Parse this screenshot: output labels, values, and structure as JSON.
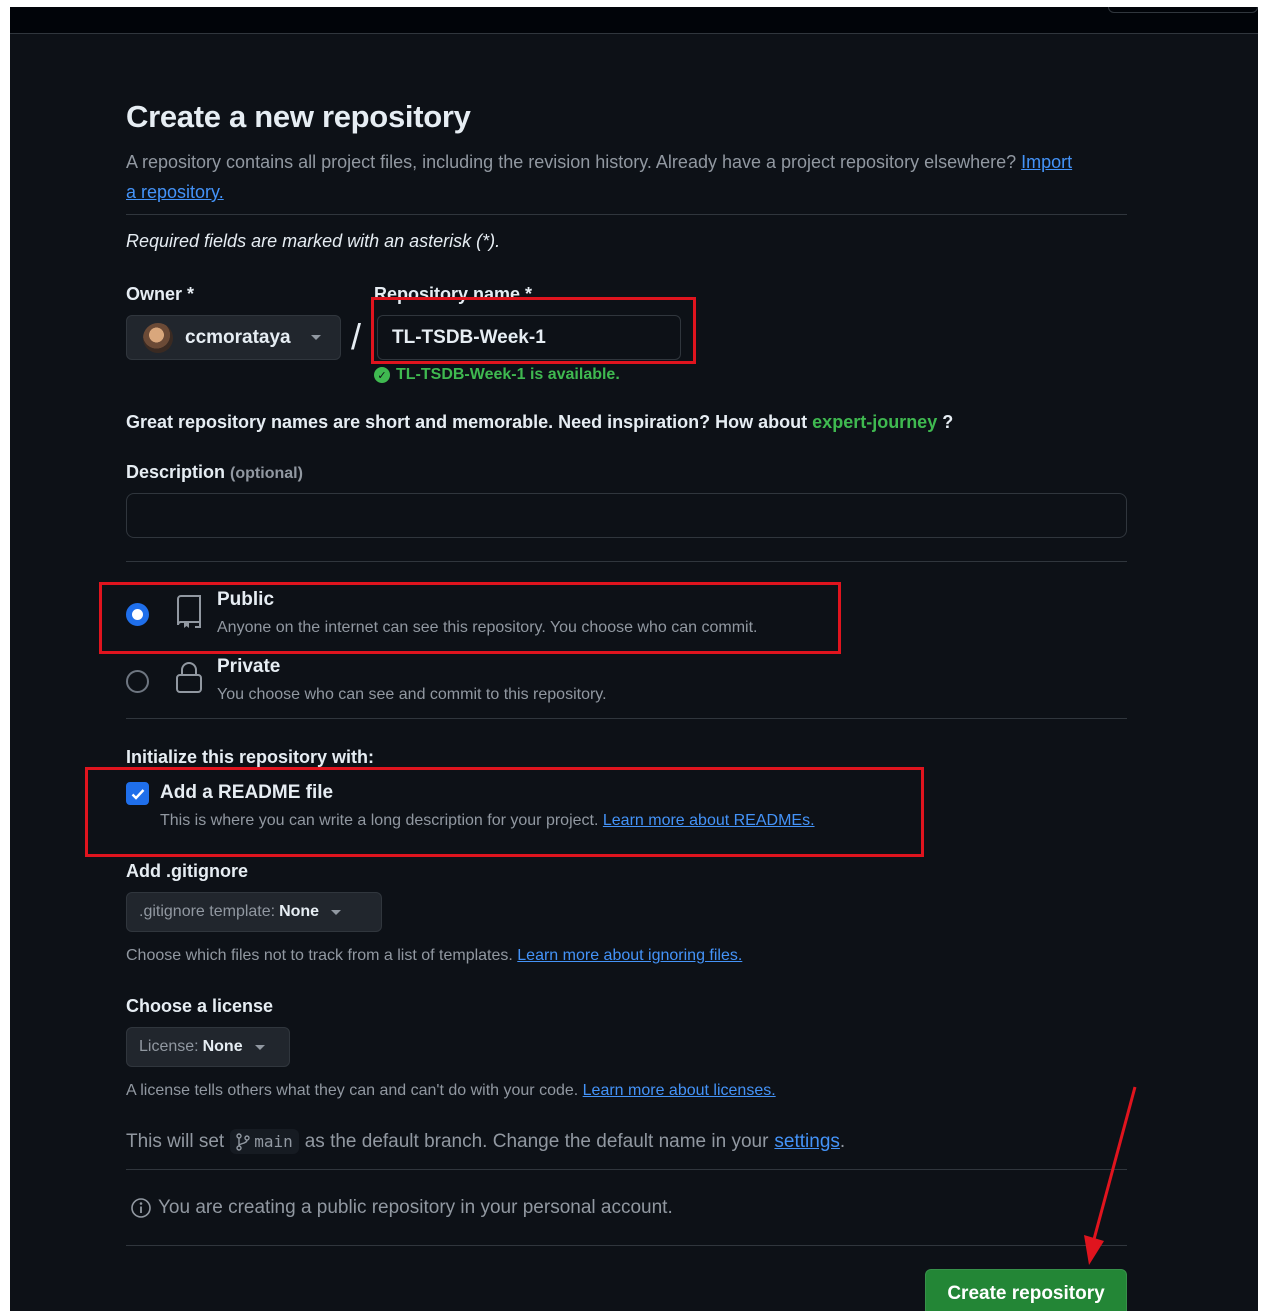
{
  "page": {
    "title": "Create a new repository",
    "intro_text": "A repository contains all project files, including the revision history. Already have a project repository elsewhere?",
    "import_link": "Import a repository.",
    "required_note": "Required fields are marked with an asterisk (*)."
  },
  "owner": {
    "label": "Owner *",
    "value": "ccmorataya"
  },
  "repo_name": {
    "label": "Repository name *",
    "value": "TL-TSDB-Week-1",
    "availability": "TL-TSDB-Week-1 is available."
  },
  "suggestion": {
    "text": "Great repository names are short and memorable. Need inspiration? How about",
    "name": "expert-journey",
    "suffix": "?"
  },
  "description": {
    "label": "Description",
    "optional": "(optional)",
    "value": ""
  },
  "visibility": {
    "public": {
      "title": "Public",
      "desc": "Anyone on the internet can see this repository. You choose who can commit.",
      "selected": true
    },
    "private": {
      "title": "Private",
      "desc": "You choose who can see and commit to this repository.",
      "selected": false
    }
  },
  "initialize": {
    "heading": "Initialize this repository with:",
    "readme_title": "Add a README file",
    "readme_desc": "This is where you can write a long description for your project.",
    "readme_link": "Learn more about READMEs.",
    "readme_checked": true
  },
  "gitignore": {
    "heading": "Add .gitignore",
    "select_prefix": ".gitignore template:",
    "select_value": "None",
    "hint": "Choose which files not to track from a list of templates.",
    "hint_link": "Learn more about ignoring files."
  },
  "license": {
    "heading": "Choose a license",
    "select_prefix": "License:",
    "select_value": "None",
    "hint": "A license tells others what they can and can't do with your code.",
    "hint_link": "Learn more about licenses."
  },
  "branch": {
    "prefix": "This will set",
    "name": "main",
    "middle": "as the default branch. Change the default name in your",
    "settings_link": "settings",
    "end": "."
  },
  "notice": "You are creating a public repository in your personal account.",
  "create_button": "Create repository",
  "colors": {
    "background": "#0d1117",
    "accent_blue": "#1f6feb",
    "link": "#4493f8",
    "success_green": "#3fb950",
    "button_green": "#238636",
    "annotation_red": "#e0141e"
  },
  "icons": [
    "repo-icon",
    "lock-icon",
    "check-circle-icon",
    "git-branch-icon",
    "info-icon",
    "checkmark-icon",
    "caret-down-icon"
  ]
}
